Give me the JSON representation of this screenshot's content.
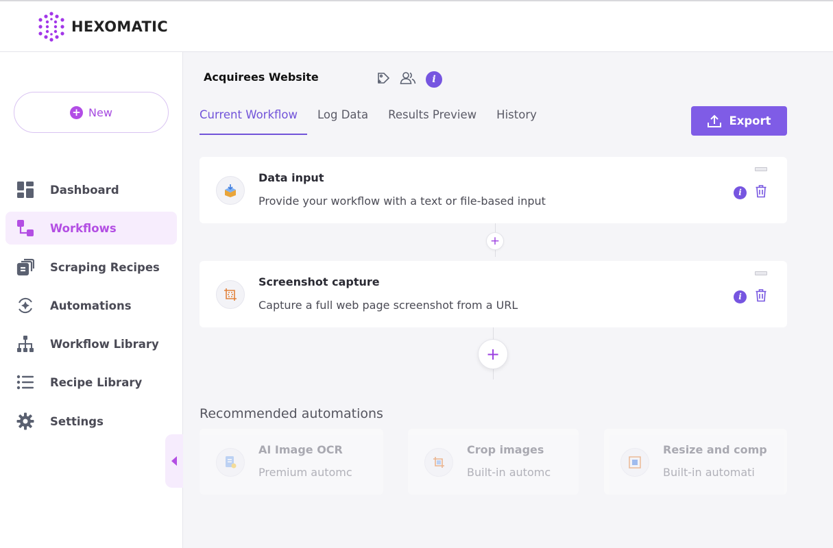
{
  "app": {
    "brand": "HEXOMATIC",
    "accent": "#7f5ce6",
    "brand_purple": "#b34ee3"
  },
  "sidebar": {
    "new_label": "New",
    "items": [
      {
        "label": "Dashboard",
        "icon": "dashboard-icon",
        "active": false
      },
      {
        "label": "Workflows",
        "icon": "workflows-icon",
        "active": true
      },
      {
        "label": "Scraping Recipes",
        "icon": "scraping-recipes-icon",
        "active": false
      },
      {
        "label": "Automations",
        "icon": "automations-icon",
        "active": false
      },
      {
        "label": "Workflow Library",
        "icon": "workflow-library-icon",
        "active": false
      },
      {
        "label": "Recipe Library",
        "icon": "recipe-library-icon",
        "active": false
      },
      {
        "label": "Settings",
        "icon": "gear-icon",
        "active": false
      }
    ]
  },
  "workflow": {
    "title": "Acquirees Website",
    "tabs": [
      {
        "label": "Current Workflow",
        "active": true
      },
      {
        "label": "Log Data",
        "active": false
      },
      {
        "label": "Results Preview",
        "active": false
      },
      {
        "label": "History",
        "active": false
      }
    ],
    "export_label": "Export",
    "steps": [
      {
        "title": "Data input",
        "description": "Provide your workflow with a text or file-based input",
        "icon": "data-input-icon"
      },
      {
        "title": "Screenshot capture",
        "description": "Capture a full web page screenshot from a URL",
        "icon": "crop-frame-icon"
      }
    ]
  },
  "recommended": {
    "title": "Recommended automations",
    "items": [
      {
        "title": "AI Image OCR",
        "subtitle": "Premium automc",
        "icon": "ocr-icon"
      },
      {
        "title": "Crop images",
        "subtitle": "Built-in automc",
        "icon": "crop-icon"
      },
      {
        "title": "Resize and comp",
        "subtitle": "Built-in automati",
        "icon": "resize-icon"
      }
    ]
  }
}
